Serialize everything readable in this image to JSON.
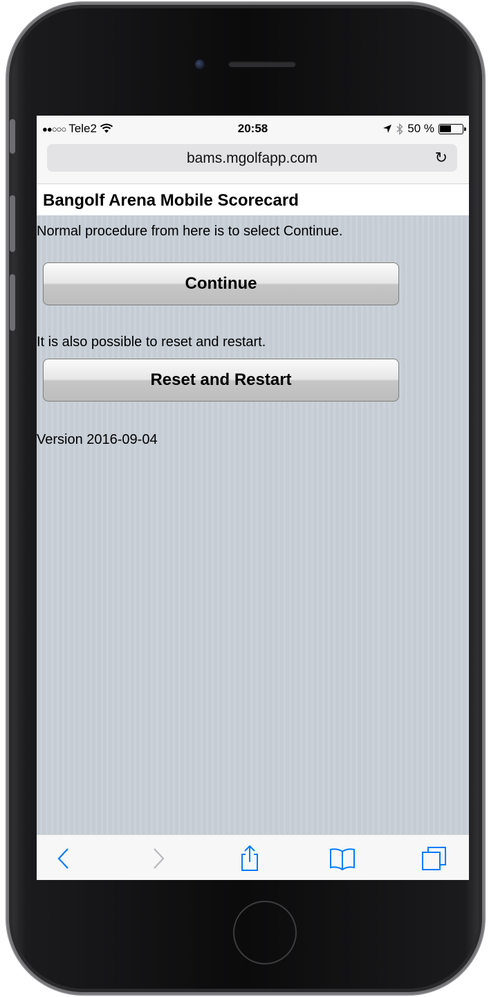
{
  "status_bar": {
    "signal": "●●○○○",
    "carrier": "Tele2",
    "wifi_icon": "wifi-icon",
    "time": "20:58",
    "location_icon": "location-arrow-icon",
    "bluetooth_icon": "bluetooth-icon",
    "battery_percent": "50 %",
    "battery_level": 0.5
  },
  "browser": {
    "url": "bams.mgolfapp.com",
    "reload_icon": "reload-icon"
  },
  "page": {
    "title": "Bangolf Arena Mobile Scorecard",
    "continue_hint": "Normal procedure from here is to select Continue.",
    "continue_label": "Continue",
    "reset_hint": "It is also possible to reset and restart.",
    "reset_label": "Reset and Restart",
    "version": "Version 2016-09-04"
  },
  "toolbar": {
    "back_icon": "chevron-left-icon",
    "forward_icon": "chevron-right-icon",
    "share_icon": "share-icon",
    "bookmarks_icon": "book-icon",
    "tabs_icon": "tabs-icon"
  },
  "colors": {
    "accent": "#007aff",
    "disabled": "#b8b8bd",
    "content_bg": "#c5ccd4"
  }
}
